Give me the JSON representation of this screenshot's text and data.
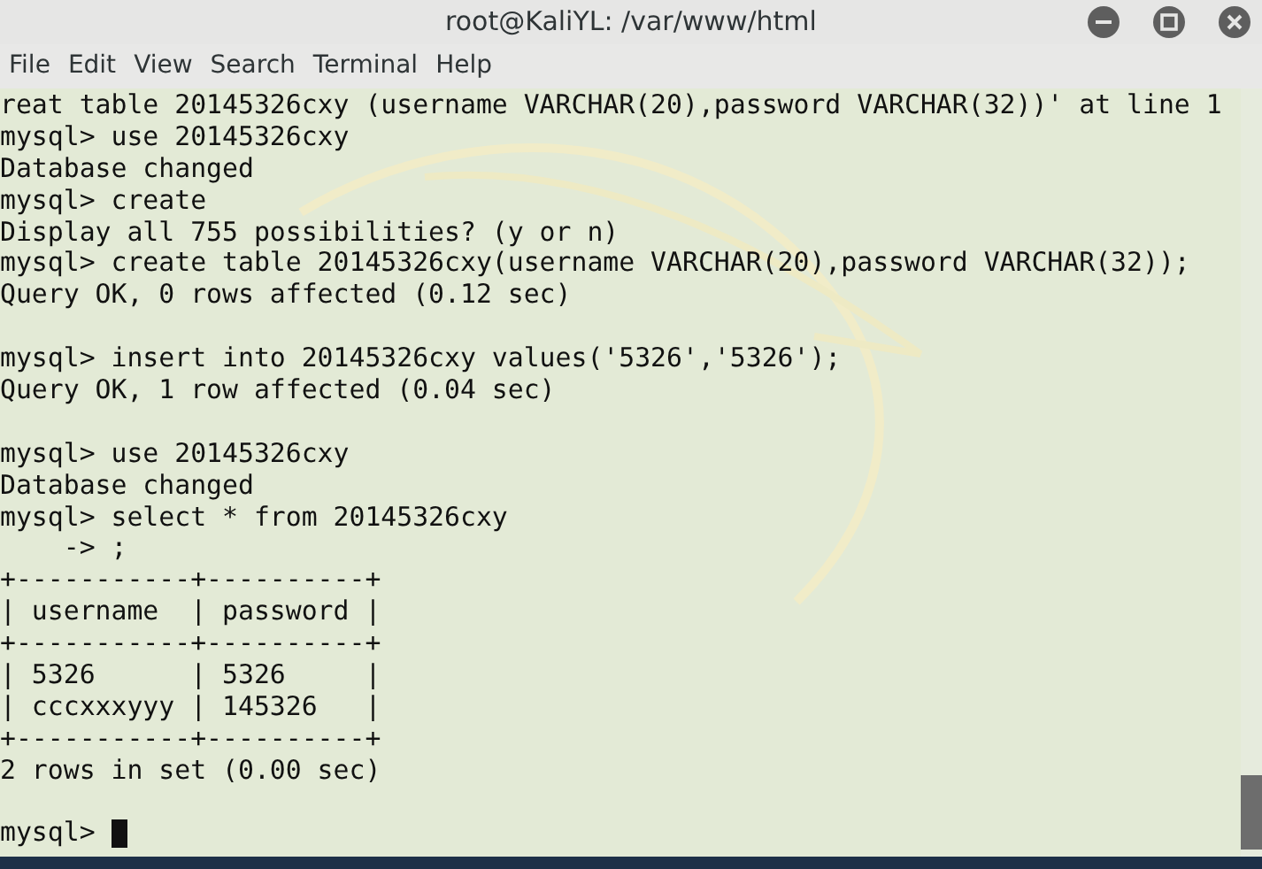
{
  "window": {
    "title": "root@KaliYL: /var/www/html"
  },
  "menu": [
    "File",
    "Edit",
    "View",
    "Search",
    "Terminal",
    "Help"
  ],
  "terminal": {
    "blocks": [
      [
        "reat table 20145326cxy (username VARCHAR(20),password VARCHAR(32))' at line 1",
        "mysql> use 20145326cxy",
        "Database changed",
        "mysql> create",
        "Display all 755 possibilities? (y or n)",
        "mysql> create table 20145326cxy(username VARCHAR(20),password VARCHAR(32));",
        "Query OK, 0 rows affected (0.12 sec)"
      ],
      [
        "mysql> insert into 20145326cxy values('5326','5326');",
        "Query OK, 1 row affected (0.04 sec)"
      ],
      [
        "mysql> use 20145326cxy",
        "Database changed",
        "mysql> select * from 20145326cxy",
        "    -> ;",
        "+-----------+----------+",
        "| username  | password |",
        "+-----------+----------+",
        "| 5326      | 5326     |",
        "| cccxxxyyy | 145326   |",
        "+-----------+----------+",
        "2 rows in set (0.00 sec)"
      ]
    ],
    "prompt": "mysql> "
  }
}
